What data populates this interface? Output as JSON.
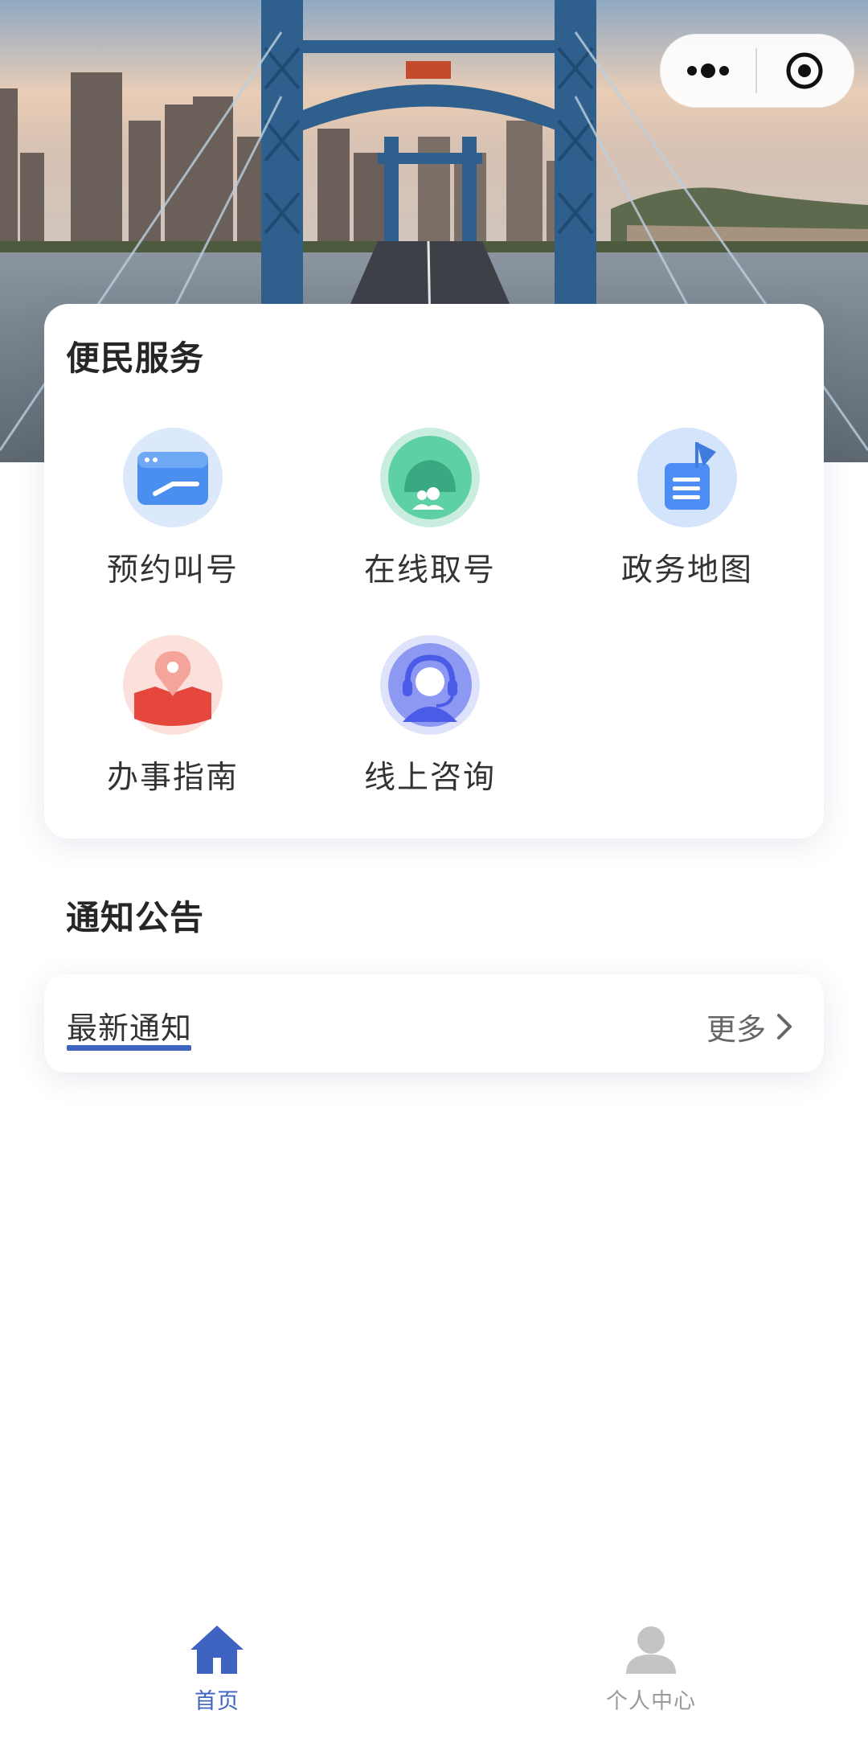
{
  "capsule": {
    "more_icon": "more-dots-icon",
    "close_icon": "target-circle-icon"
  },
  "services": {
    "title": "便民服务",
    "items": [
      {
        "label": "预约叫号",
        "icon": "appointment-window-icon",
        "color": "#4a8ff0"
      },
      {
        "label": "在线取号",
        "icon": "take-number-icon",
        "color": "#47c49a"
      },
      {
        "label": "政务地图",
        "icon": "map-flag-icon",
        "color": "#4c8ef5"
      },
      {
        "label": "办事指南",
        "icon": "guide-pin-icon",
        "color": "#e5473d"
      },
      {
        "label": "线上咨询",
        "icon": "consult-headset-icon",
        "color": "#5a6ef0"
      }
    ]
  },
  "notice": {
    "title": "通知公告",
    "tab_label": "最新通知",
    "more_label": "更多",
    "accent": "#3f63c0"
  },
  "tabbar": {
    "items": [
      {
        "label": "首页",
        "icon": "home-icon",
        "active": true,
        "color": "#3f63c0"
      },
      {
        "label": "个人中心",
        "icon": "person-icon",
        "active": false,
        "color": "#9a9a9a"
      }
    ]
  }
}
